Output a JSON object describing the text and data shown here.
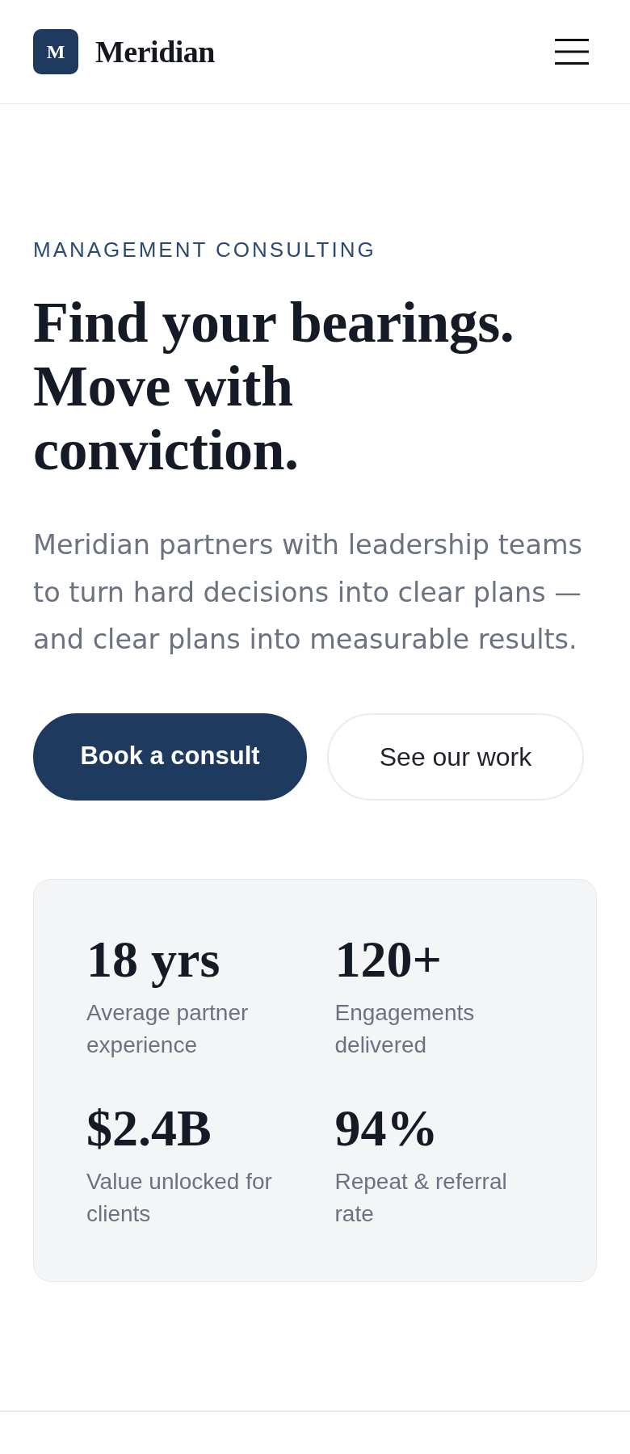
{
  "header": {
    "logo": {
      "mark": "M",
      "name": "Meridian"
    }
  },
  "hero": {
    "eyebrow": "MANAGEMENT CONSULTING",
    "headline": "Find your bearings. Move with conviction.",
    "description": "Meridian partners with leadership teams to turn hard decisions into clear plans — and clear plans into measurable results.",
    "buttons": [
      {
        "label": "Book a consult",
        "kind": "primary"
      },
      {
        "label": "See our work",
        "kind": "secondary"
      }
    ]
  },
  "stats": [
    {
      "value": "18 yrs",
      "label": "Average partner experience"
    },
    {
      "value": "120+",
      "label": "Engagements delivered"
    },
    {
      "value": "$2.4B",
      "label": "Value unlocked for clients"
    },
    {
      "value": "94%",
      "label": "Repeat & referral rate"
    }
  ]
}
